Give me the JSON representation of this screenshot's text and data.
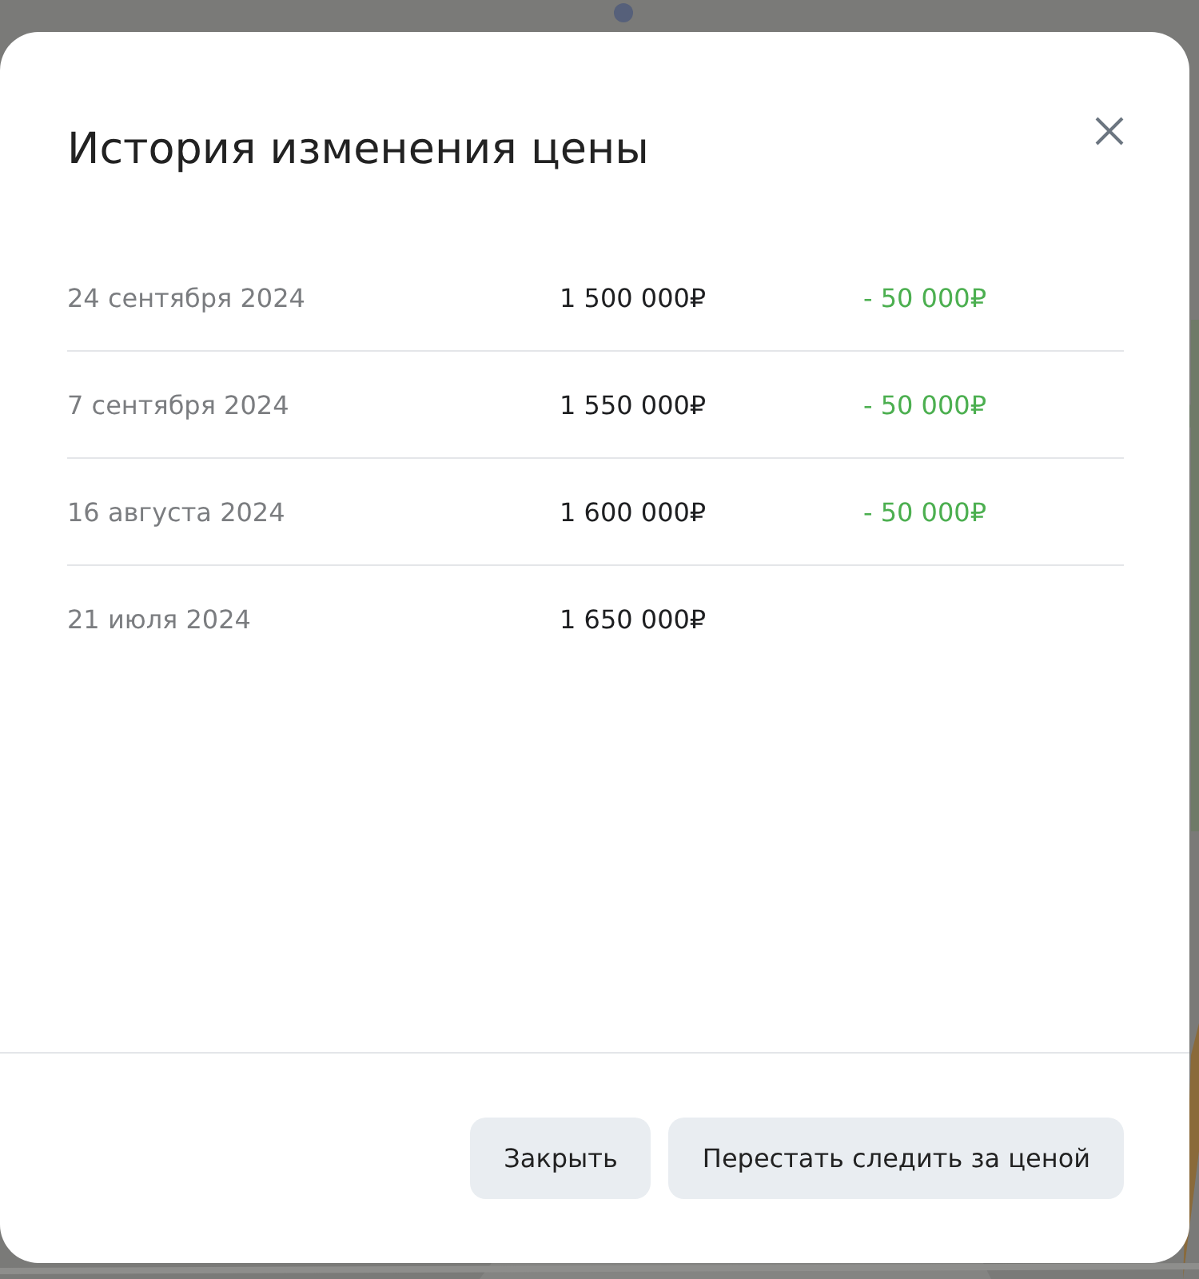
{
  "dialog": {
    "title": "История изменения цены",
    "rows": [
      {
        "date": "24 сентября 2024",
        "price": "1 500 000₽",
        "change": "- 50 000₽"
      },
      {
        "date": "7 сентября 2024",
        "price": "1 550 000₽",
        "change": "- 50 000₽"
      },
      {
        "date": "16 августа 2024",
        "price": "1 600 000₽",
        "change": "- 50 000₽"
      },
      {
        "date": "21 июля 2024",
        "price": "1 650 000₽"
      }
    ],
    "buttons": [
      "Закрыть",
      "Перестать следить за ценой"
    ]
  }
}
